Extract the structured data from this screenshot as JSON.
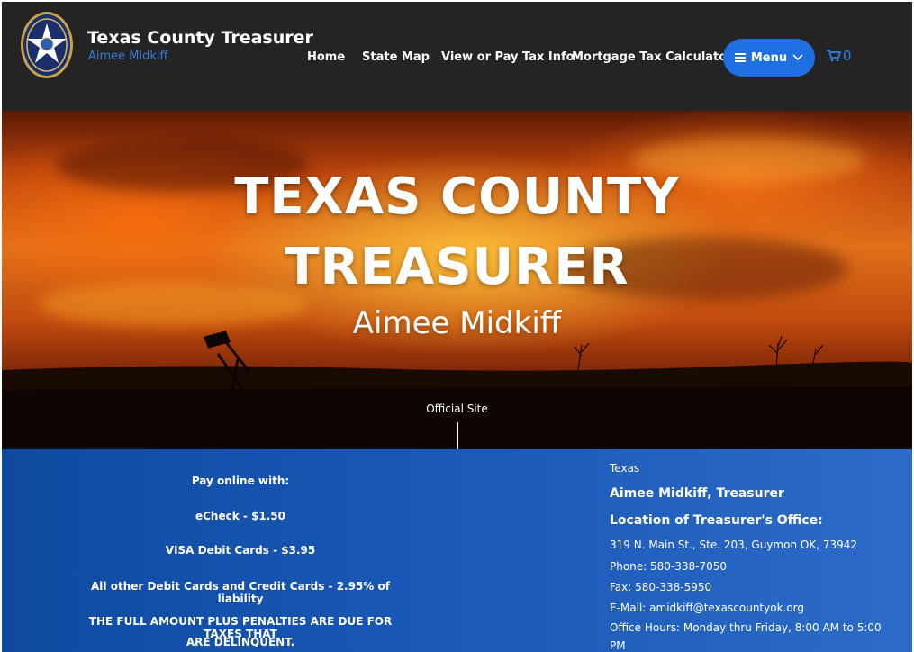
{
  "header": {
    "title": "Texas County Treasurer",
    "subtitle": "Aimee Midkiff",
    "seal_icon": "state-seal-icon",
    "nav": [
      {
        "label": "Home"
      },
      {
        "label": "State Map"
      },
      {
        "label": "View or Pay Tax Info"
      },
      {
        "label": "Mortgage Tax Calculator"
      }
    ],
    "menu_label": "Menu",
    "cart_count": "0",
    "accent": "#1e6fe0"
  },
  "hero": {
    "title_line1": "TEXAS COUNTY",
    "title_line2": "TREASURER",
    "name": "Aimee Midkiff",
    "official": "Official Site"
  },
  "payment": {
    "heading": "Pay online with:",
    "echeck": "eCheck - $1.50",
    "visa": "VISA Debit Cards - $3.95",
    "other": "All other Debit Cards and Credit Cards - 2.95% of liability",
    "notice_line1": "THE FULL AMOUNT PLUS PENALTIES ARE DUE FOR TAXES THAT",
    "notice_line2": "ARE DELINQUENT."
  },
  "office": {
    "state": "Texas",
    "treasurer": "Aimee Midkiff, Treasurer",
    "location_heading": "Location of Treasurer's Office:",
    "address": "319 N. Main St., Ste. 203, Guymon OK, 73942",
    "phone": "Phone: 580-338-7050",
    "fax": "Fax: 580-338-5950",
    "email": "E-Mail: amidkiff@texascountyok.org",
    "hours_line1": "Office Hours: Monday thru Friday, 8:00 AM to 5:00",
    "hours_line2": "PM"
  }
}
